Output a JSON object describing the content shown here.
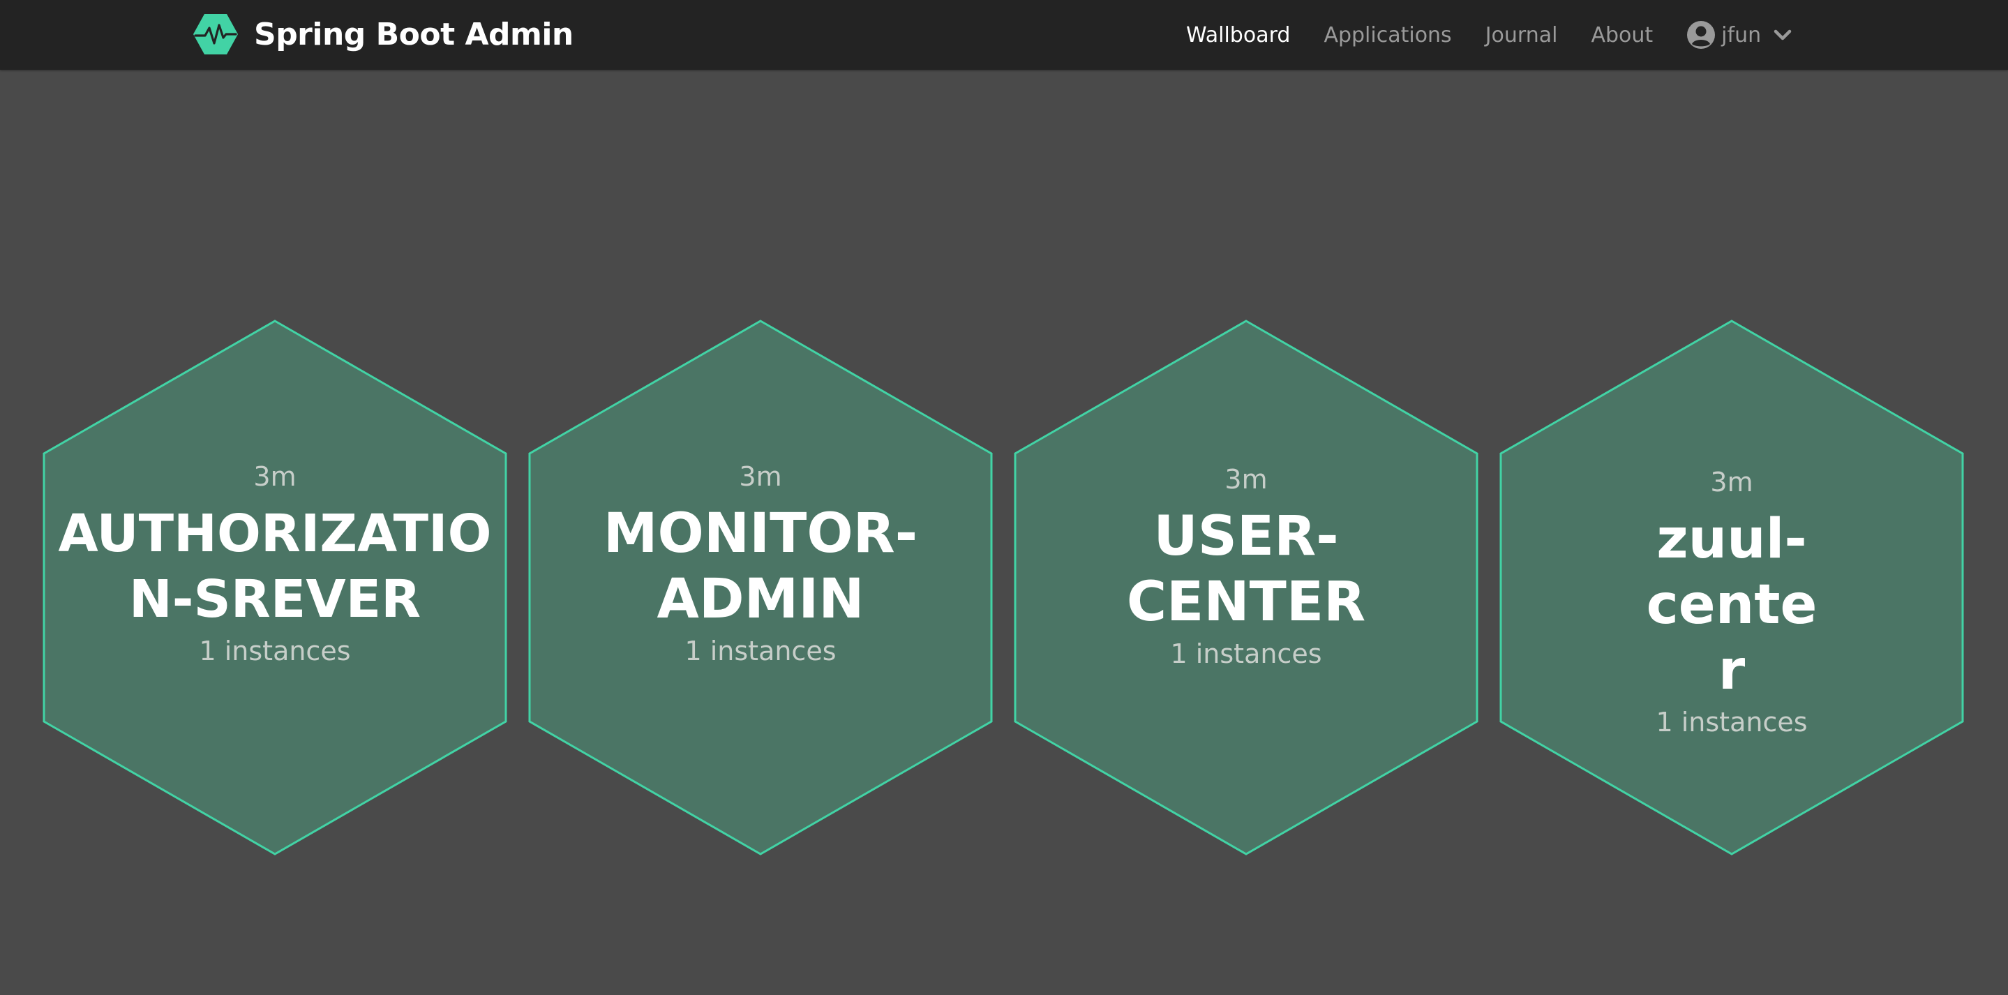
{
  "navbar": {
    "brand_title": "Spring Boot Admin",
    "brand_logo_icon": "heartbeat-hexagon-icon",
    "links": [
      {
        "label": "Wallboard",
        "active": true
      },
      {
        "label": "Applications",
        "active": false
      },
      {
        "label": "Journal",
        "active": false
      },
      {
        "label": "About",
        "active": false
      }
    ],
    "user": {
      "name": "jfun",
      "icon": "user-circle-icon",
      "dropdown_icon": "chevron-down-icon"
    }
  },
  "wallboard": {
    "applications": [
      {
        "time": "3m",
        "name": "AUTHORIZATION-SREVER",
        "instances": "1 instances",
        "status": "UP"
      },
      {
        "time": "3m",
        "name": "MONITOR-ADMIN",
        "instances": "1 instances",
        "status": "UP"
      },
      {
        "time": "3m",
        "name": "USER-CENTER",
        "instances": "1 instances",
        "status": "UP"
      },
      {
        "time": "3m",
        "name": "zuul-center",
        "instances": "1 instances",
        "status": "UP"
      }
    ]
  },
  "colors": {
    "navbar_bg": "#232323",
    "page_bg": "#4a4a4a",
    "hex_fill_up": "#4b7565",
    "hex_stroke_up": "#42d3a5",
    "brand_accent": "#42d3a5"
  }
}
